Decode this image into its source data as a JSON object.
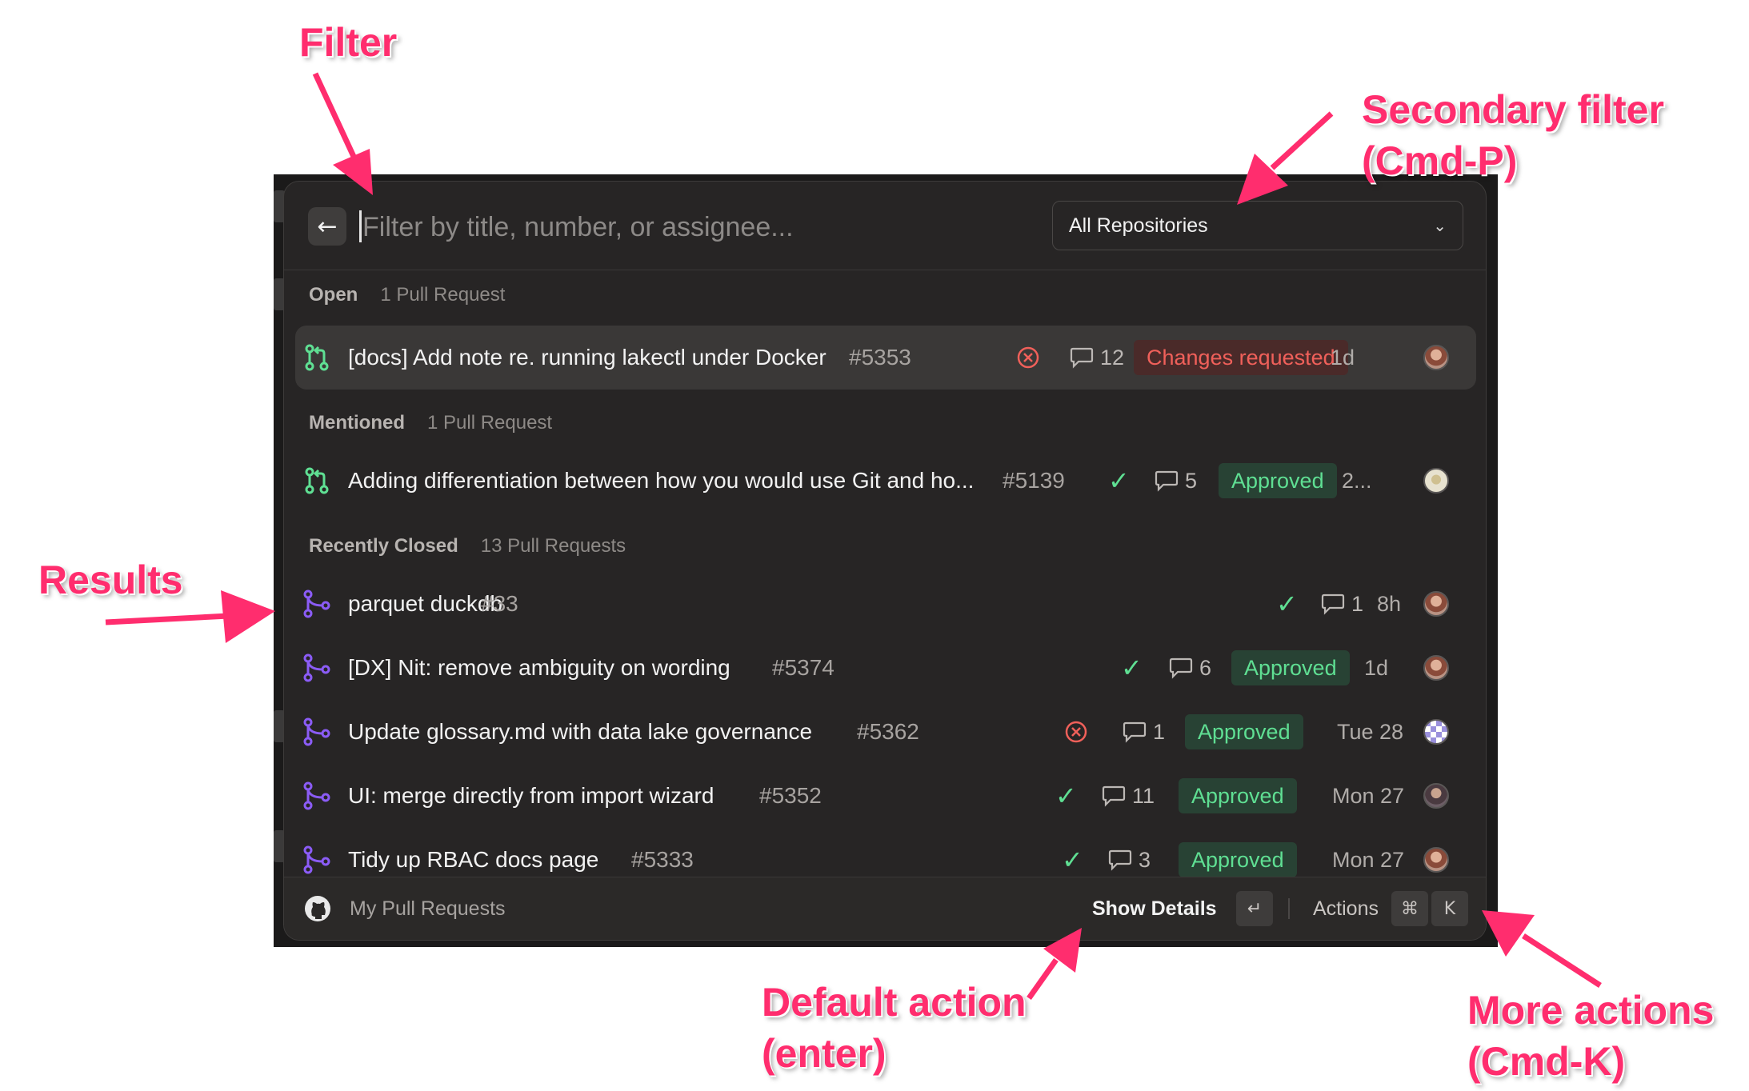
{
  "palette": {
    "search": {
      "placeholder": "Filter by title, number, or assignee..."
    },
    "repo_filter": {
      "value": "All Repositories"
    },
    "sections": [
      {
        "title": "Open",
        "count": "1 Pull Request"
      },
      {
        "title": "Mentioned",
        "count": "1 Pull Request"
      },
      {
        "title": "Recently Closed",
        "count": "13 Pull Requests"
      }
    ],
    "rows": [
      {
        "title": "[docs] Add note re. running lakectl under Docker",
        "number": "#5353",
        "comments": "12",
        "status": "Changes requested",
        "age": "1d"
      },
      {
        "title": "Adding differentiation between how you would use Git and ho...",
        "number": "#5139",
        "comments": "5",
        "status": "Approved",
        "age": "2..."
      },
      {
        "title": "parquet duckdb",
        "number": "#33",
        "comments": "1",
        "age": "8h"
      },
      {
        "title": "[DX] Nit: remove ambiguity on wording",
        "number": "#5374",
        "comments": "6",
        "status": "Approved",
        "age": "1d"
      },
      {
        "title": "Update glossary.md with data lake governance",
        "number": "#5362",
        "comments": "1",
        "status": "Approved",
        "age": "Tue 28"
      },
      {
        "title": "UI: merge directly from import wizard",
        "number": "#5352",
        "comments": "11",
        "status": "Approved",
        "age": "Mon 27"
      },
      {
        "title": "Tidy up RBAC docs page",
        "number": "#5333",
        "comments": "3",
        "status": "Approved",
        "age": "Mon 27"
      }
    ],
    "footer": {
      "title": "My Pull Requests",
      "primary_action": "Show Details",
      "enter_key": "↵",
      "actions_label": "Actions",
      "cmd_key": "⌘",
      "k_key": "K"
    }
  },
  "annotations": {
    "filter": "Filter",
    "secondary_filter_1": "Secondary filter",
    "secondary_filter_2": "(Cmd-P)",
    "results": "Results",
    "default_action_1": "Default action",
    "default_action_2": "(enter)",
    "more_actions_1": "More actions",
    "more_actions_2": "(Cmd-K)"
  },
  "colors": {
    "open_pr_icon": "#5fdf93",
    "merged_pr_icon": "#8b5cf6",
    "approved": "#5fdf93",
    "changes_requested": "#f0605a",
    "annotation": "#ff2d6e"
  },
  "icons": {
    "open_pr": "git-pull-request-icon",
    "merged_pr": "git-merge-icon",
    "failed_check": "x-circle-icon",
    "passed_check": "check-icon",
    "comments": "comment-icon",
    "footer": "github-icon"
  }
}
